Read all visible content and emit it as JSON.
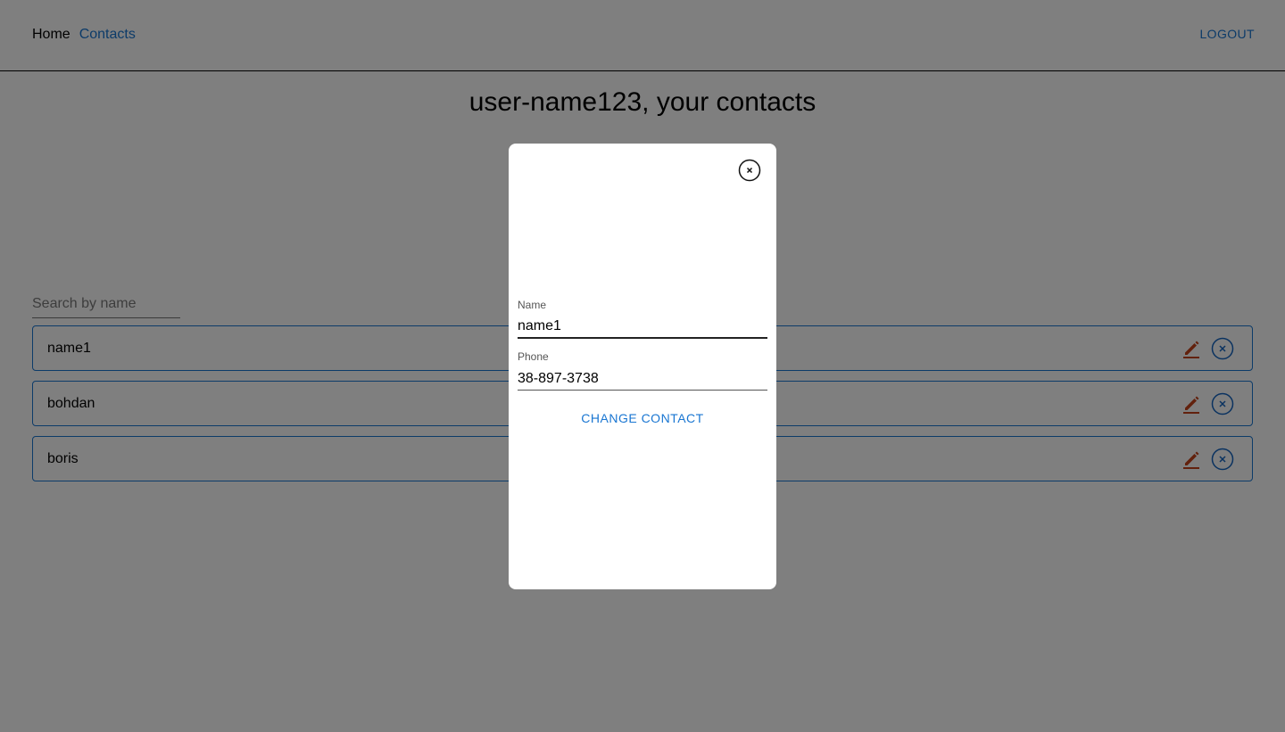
{
  "header": {
    "nav": {
      "home": "Home",
      "contacts": "Contacts"
    },
    "logout_label": "LOGOUT"
  },
  "page_title": "user-name123, your contacts",
  "search": {
    "placeholder": "Search by name",
    "value": ""
  },
  "contacts": [
    {
      "name": "name1"
    },
    {
      "name": "bohdan"
    },
    {
      "name": "boris"
    }
  ],
  "modal": {
    "name_label": "Name",
    "name_value": "name1",
    "phone_label": "Phone",
    "phone_value": "38-897-3738",
    "submit_label": "CHANGE CONTACT"
  },
  "colors": {
    "accent": "#1976d2",
    "edit_icon": "#c4421a",
    "overlay": "rgba(0,0,0,0.5)"
  },
  "icons": {
    "edit": "pencil-icon",
    "delete": "close-circle-icon",
    "modal_close": "close-circle-icon"
  }
}
